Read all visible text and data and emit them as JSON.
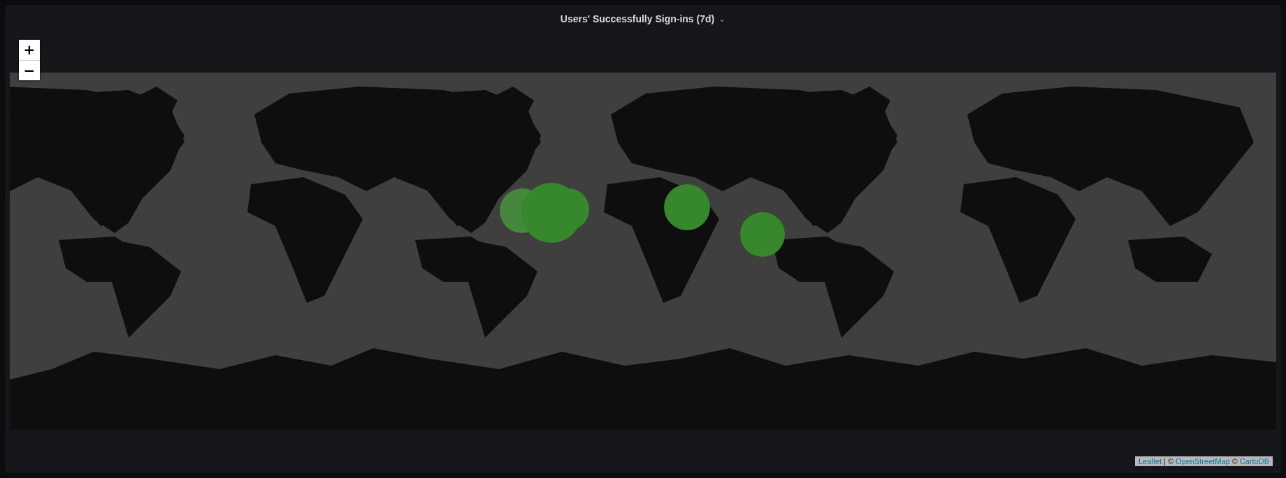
{
  "panel": {
    "title": "Users' Successfully Sign-ins (7d)",
    "title_menu": "⌄"
  },
  "map": {
    "kind": "picture",
    "zoom_controls": [
      "+",
      "−"
    ],
    "markers": [
      {
        "color": "#45873b"
      },
      {
        "color": "#37872d"
      },
      {
        "color": "#37872d"
      },
      {
        "color": "#37872d"
      },
      {
        "color": "#37872d"
      }
    ],
    "attribution": {
      "links": [
        "Leaflet",
        "OpenStreetMap",
        "CartoDB"
      ],
      "separators": [
        "| ©",
        "©"
      ]
    }
  }
}
